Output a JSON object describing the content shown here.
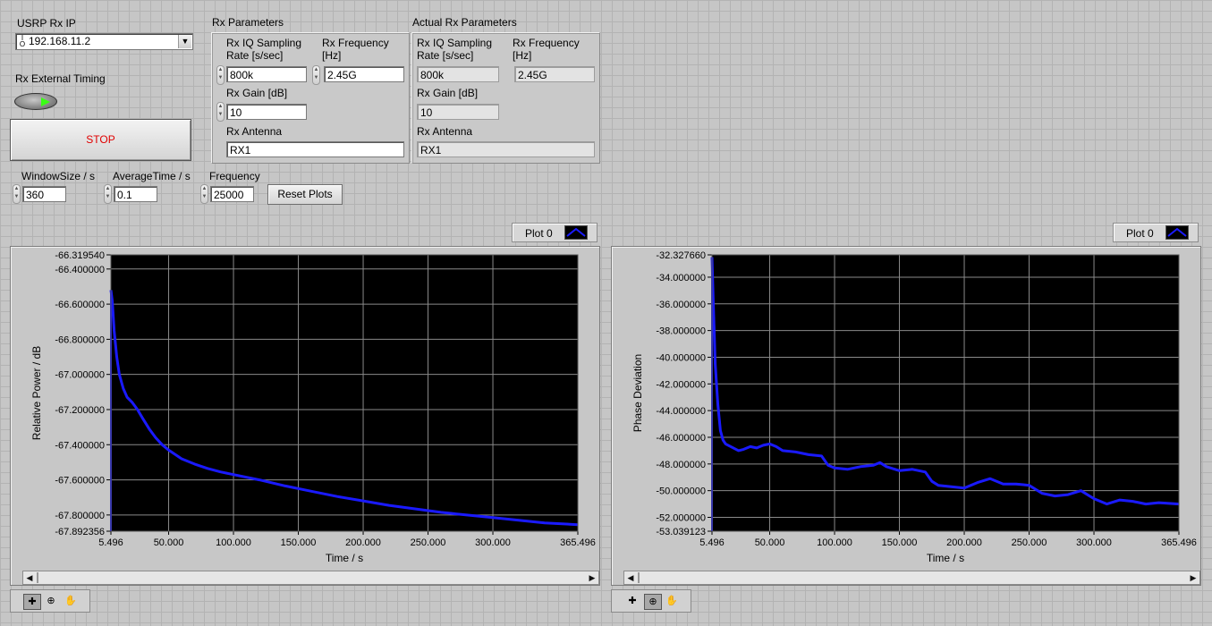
{
  "usrp": {
    "ip_label": "USRP Rx IP",
    "ip_value": "192.168.11.2",
    "io_glyph": "I/O"
  },
  "timing": {
    "label": "Rx External Timing"
  },
  "stop": {
    "label": "STOP"
  },
  "rx_params": {
    "title": "Rx Parameters",
    "iq_rate_label": "Rx IQ Sampling Rate [s/sec]",
    "iq_rate_value": "800k",
    "freq_label": "Rx Frequency [Hz]",
    "freq_value": "2.45G",
    "gain_label": "Rx Gain [dB]",
    "gain_value": "10",
    "antenna_label": "Rx Antenna",
    "antenna_value": "RX1"
  },
  "actual_params": {
    "title": "Actual Rx Parameters",
    "iq_rate_label": "Rx IQ Sampling Rate [s/sec]",
    "iq_rate_value": "800k",
    "freq_label": "Rx Frequency [Hz]",
    "freq_value": "2.45G",
    "gain_label": "Rx Gain [dB]",
    "gain_value": "10",
    "antenna_label": "Rx Antenna",
    "antenna_value": "RX1"
  },
  "controls": {
    "window_label": "WindowSize / s",
    "window_value": "360",
    "avg_label": "AverageTime / s",
    "avg_value": "0.1",
    "freq_label": "Frequency",
    "freq_value": "25000",
    "reset_label": "Reset Plots"
  },
  "colors": {
    "plot_line": "#1a1aff",
    "plot_bg": "#000000",
    "grid": "#8a8a8a",
    "led_on": "#39ff14"
  },
  "chart_data": [
    {
      "type": "line",
      "legend": "Plot 0",
      "xlabel": "Time / s",
      "ylabel": "Relative Power / dB",
      "xlim": [
        5.496,
        365.496
      ],
      "ylim": [
        -67.892356,
        -66.31954
      ],
      "x_ticks": [
        "5.496",
        "50.000",
        "100.000",
        "150.000",
        "200.000",
        "250.000",
        "300.000",
        "365.496"
      ],
      "y_ticks": [
        "-66.319540",
        "-66.400000",
        "-66.600000",
        "-66.800000",
        "-67.000000",
        "-67.200000",
        "-67.400000",
        "-67.600000",
        "-67.800000",
        "-67.892356"
      ],
      "series": [
        {
          "x": [
            5.496,
            6.5,
            8,
            10,
            12,
            15,
            18,
            22,
            26,
            30,
            35,
            40,
            45,
            50,
            60,
            70,
            80,
            90,
            100,
            120,
            140,
            160,
            180,
            200,
            220,
            240,
            260,
            280,
            300,
            320,
            340,
            365.496
          ],
          "y": [
            -66.52,
            -66.58,
            -66.75,
            -66.9,
            -67.0,
            -67.08,
            -67.13,
            -67.16,
            -67.2,
            -67.25,
            -67.31,
            -67.36,
            -67.4,
            -67.43,
            -67.48,
            -67.51,
            -67.535,
            -67.555,
            -67.57,
            -67.6,
            -67.635,
            -67.665,
            -67.695,
            -67.72,
            -67.745,
            -67.765,
            -67.785,
            -67.8,
            -67.815,
            -67.83,
            -67.845,
            -67.855
          ]
        }
      ]
    },
    {
      "type": "line",
      "legend": "Plot 0",
      "xlabel": "Time / s",
      "ylabel": "Phase Deviation",
      "xlim": [
        5.496,
        365.496
      ],
      "ylim": [
        -53.039123,
        -32.32766
      ],
      "x_ticks": [
        "5.496",
        "50.000",
        "100.000",
        "150.000",
        "200.000",
        "250.000",
        "300.000",
        "365.496"
      ],
      "y_ticks": [
        "-32.327660",
        "-34.000000",
        "-36.000000",
        "-38.000000",
        "-40.000000",
        "-42.000000",
        "-44.000000",
        "-46.000000",
        "-48.000000",
        "-50.000000",
        "-52.000000",
        "-53.039123"
      ],
      "series": [
        {
          "x": [
            5.496,
            6.5,
            8,
            10,
            12,
            14,
            16,
            18,
            22,
            26,
            30,
            35,
            40,
            45,
            50,
            55,
            60,
            70,
            80,
            90,
            95,
            100,
            110,
            120,
            130,
            135,
            140,
            150,
            160,
            170,
            175,
            180,
            190,
            200,
            210,
            220,
            230,
            240,
            250,
            260,
            270,
            280,
            290,
            300,
            310,
            320,
            330,
            340,
            350,
            365.496
          ],
          "y": [
            -32.5,
            -36.0,
            -40.5,
            -43.5,
            -45.5,
            -46.2,
            -46.5,
            -46.6,
            -46.8,
            -47.0,
            -46.9,
            -46.7,
            -46.8,
            -46.6,
            -46.5,
            -46.7,
            -47.0,
            -47.1,
            -47.3,
            -47.4,
            -48.1,
            -48.3,
            -48.4,
            -48.2,
            -48.1,
            -47.9,
            -48.2,
            -48.5,
            -48.4,
            -48.6,
            -49.3,
            -49.6,
            -49.7,
            -49.8,
            -49.4,
            -49.1,
            -49.5,
            -49.5,
            -49.6,
            -50.2,
            -50.4,
            -50.3,
            -50.0,
            -50.6,
            -51.0,
            -50.7,
            -50.8,
            -51.0,
            -50.9,
            -51.0
          ]
        }
      ]
    }
  ]
}
